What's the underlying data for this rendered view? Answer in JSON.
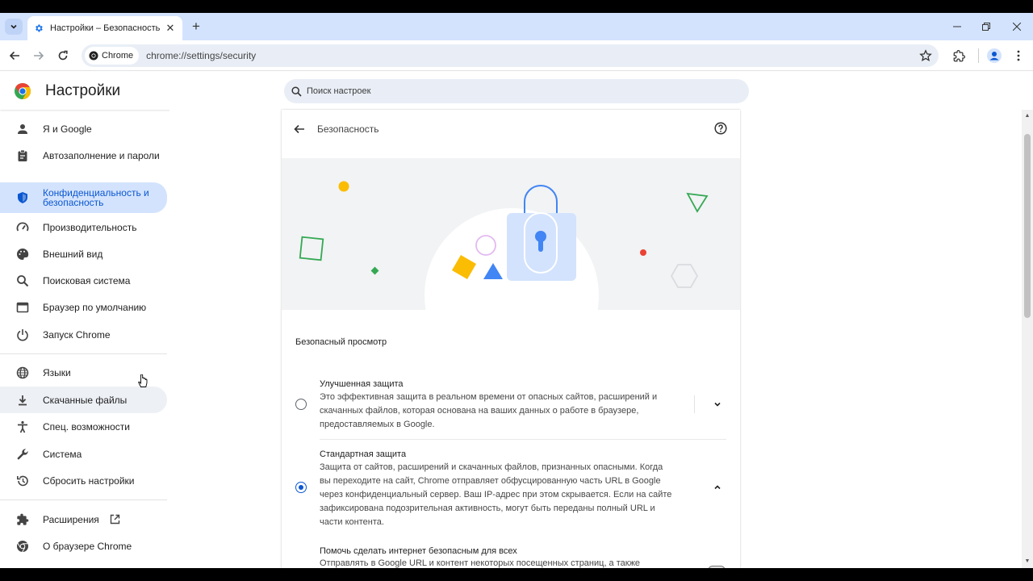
{
  "browser": {
    "tab_title": "Настройки – Безопасность",
    "chip_label": "Chrome",
    "url": "chrome://settings/security",
    "colors": {
      "tabstrip": "#d3e3fd",
      "accent": "#0b57d0",
      "omnibox": "#e9eef6"
    }
  },
  "header": {
    "title": "Настройки",
    "search_placeholder": "Поиск настроек"
  },
  "sidebar": {
    "items": [
      {
        "label": "Я и Google",
        "icon": "person-icon"
      },
      {
        "label": "Автозаполнение и пароли",
        "icon": "clipboard-icon"
      },
      {
        "label": "Конфиденциальность и безопасность",
        "icon": "shield-icon",
        "active": true
      },
      {
        "label": "Производительность",
        "icon": "speedometer-icon"
      },
      {
        "label": "Внешний вид",
        "icon": "palette-icon"
      },
      {
        "label": "Поисковая система",
        "icon": "search-icon"
      },
      {
        "label": "Браузер по умолчанию",
        "icon": "browser-window-icon"
      },
      {
        "label": "Запуск Chrome",
        "icon": "power-icon"
      },
      {
        "label": "Языки",
        "icon": "globe-icon"
      },
      {
        "label": "Скачанные файлы",
        "icon": "download-icon"
      },
      {
        "label": "Спец. возможности",
        "icon": "accessibility-icon"
      },
      {
        "label": "Система",
        "icon": "wrench-icon"
      },
      {
        "label": "Сбросить настройки",
        "icon": "reset-icon"
      },
      {
        "label": "Расширения",
        "icon": "puzzle-icon"
      },
      {
        "label": "О браузере Chrome",
        "icon": "chrome-icon"
      }
    ]
  },
  "page": {
    "title": "Безопасность",
    "section_title": "Безопасный просмотр",
    "options": [
      {
        "title": "Улучшенная защита",
        "description": "Это эффективная защита в реальном времени от опасных сайтов, расширений и скачанных файлов, которая основана на ваших данных о работе в браузере, предоставляемых в Google.",
        "selected": false
      },
      {
        "title": "Стандартная защита",
        "description": "Защита от сайтов, расширений и скачанных файлов, признанных опасными. Когда вы переходите на сайт, Chrome отправляет обфусцированную часть URL в Google через конфиденциальный сервер. Ваш IP-адрес при этом скрывается. Если на сайте зафиксирована подозрительная активность, могут быть переданы полный URL и части контента.",
        "selected": true
      }
    ],
    "sub_setting": {
      "title": "Помочь сделать интернет безопасным для всех",
      "description": "Отправлять в Google URL и контент некоторых посещенных страниц, а также определенную информацию о системе (это помогает обнаруживать новые угрозы и защищать всех",
      "enabled": false
    }
  }
}
